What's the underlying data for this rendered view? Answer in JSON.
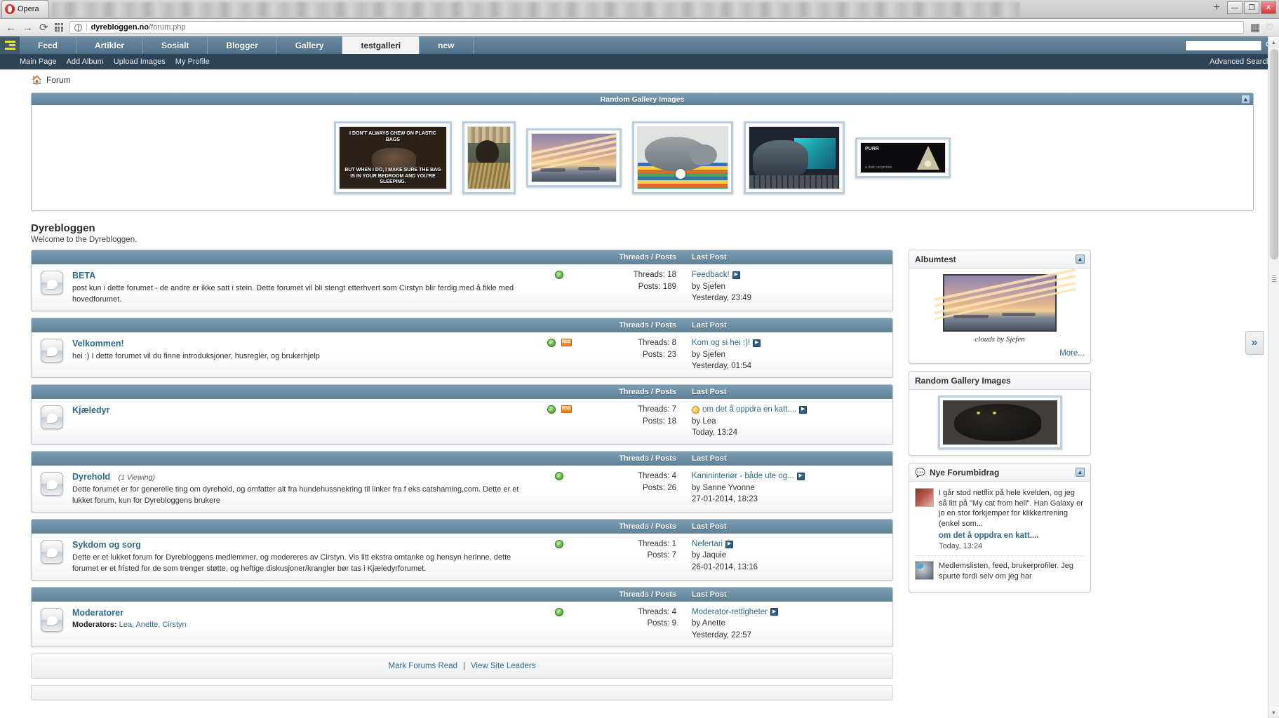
{
  "browser": {
    "tab_label": "Opera",
    "url_domain": "dyrebloggen.no",
    "url_path": "/forum.php",
    "new_tab_label": "+",
    "minimize_label": "—",
    "maximize_label": "❐",
    "close_label": "✕"
  },
  "site_nav": {
    "tabs": [
      {
        "label": "Feed",
        "active": false
      },
      {
        "label": "Artikler",
        "active": false
      },
      {
        "label": "Sosialt",
        "active": false
      },
      {
        "label": "Blogger",
        "active": false
      },
      {
        "label": "Gallery",
        "active": false
      },
      {
        "label": "testgalleri",
        "active": true
      },
      {
        "label": "new",
        "active": false
      }
    ],
    "search_value": "",
    "search_icon": "search-icon"
  },
  "sub_nav": {
    "links": [
      "Main Page",
      "Add Album",
      "Upload Images",
      "My Profile"
    ],
    "advanced_search": "Advanced Search"
  },
  "breadcrumb": {
    "home_icon": "home-icon",
    "label": "Forum"
  },
  "gallery_panel": {
    "title": "Random Gallery Images",
    "collapse_icon": "chevron-up-icon",
    "thumbs": [
      {
        "name": "meme-plastic-bags",
        "top_text": "I DON'T ALWAYS CHEW ON PLASTIC BAGS",
        "bottom_text": "BUT WHEN I DO, I MAKE SURE THE BAG IS IN YOUR BEDROOM AND YOU'RE SLEEPING."
      },
      {
        "name": "rabbit-hutch"
      },
      {
        "name": "sunset-clouds"
      },
      {
        "name": "cat-on-mat"
      },
      {
        "name": "cat-on-keyboard"
      },
      {
        "name": "dark-banner"
      }
    ]
  },
  "forum_header": {
    "title": "Dyrebloggen",
    "welcome": "Welcome to the Dyrebloggen."
  },
  "columns": {
    "threads_posts": "Threads / Posts",
    "last_post": "Last Post"
  },
  "forums": [
    {
      "name": "BETA",
      "viewing": "",
      "desc": "post kun i dette forumet - de andre er ikke satt i stein. Dette forumet vil bli stengt etterhvert som Cirstyn blir ferdig med å fikle med hovedforumet.",
      "mods": "",
      "flags": [
        "green-check-icon"
      ],
      "threads": "Threads: 18",
      "posts": "Posts: 189",
      "last_title": "Feedback!",
      "last_by": "by Sjefen",
      "last_time": "Yesterday, 23:49",
      "bulb": false
    },
    {
      "name": "Velkommen!",
      "viewing": "",
      "desc": "hei :) I dette forumet vil du finne introduksjoner, husregler, og brukerhjelp",
      "mods": "",
      "flags": [
        "green-check-icon",
        "rss-icon"
      ],
      "threads": "Threads: 8",
      "posts": "Posts: 23",
      "last_title": "Kom og si hei :)!",
      "last_by": "by Sjefen",
      "last_time": "Yesterday, 01:54",
      "bulb": false
    },
    {
      "name": "Kjæledyr",
      "viewing": "",
      "desc": "",
      "mods": "",
      "flags": [
        "green-check-icon",
        "rss-icon"
      ],
      "threads": "Threads: 7",
      "posts": "Posts: 18",
      "last_title": "om det å oppdra en katt....",
      "last_by": "by Lea",
      "last_time": "Today, 13:24",
      "bulb": true
    },
    {
      "name": "Dyrehold",
      "viewing": "(1 Viewing)",
      "desc": "Dette forumet er for generelle ting om dyrehold, og omfatter alt fra hundehussnekring til linker fra f eks catshaming,com. Dette er et lukket forum, kun for Dyrebloggens brukere",
      "mods": "",
      "flags": [
        "green-check-icon"
      ],
      "threads": "Threads: 4",
      "posts": "Posts: 26",
      "last_title": "Kanininteriør - både ute og...",
      "last_by": "by Sanne Yvonne",
      "last_time": "27-01-2014, 18:23",
      "bulb": false
    },
    {
      "name": "Sykdom og sorg",
      "viewing": "",
      "desc": "Dette er et lukket forum for Dyrebloggens medlemmer, og modereres av Cirstyn. Vis litt ekstra omtanke og hensyn herinne, dette forumet er et fristed for de som trenger støtte, og heftige diskusjoner/krangler bør tas i Kjæledyrforumet.",
      "mods": "",
      "flags": [
        "green-check-icon"
      ],
      "threads": "Threads: 1",
      "posts": "Posts: 7",
      "last_title": "Nefertari",
      "last_by": "by Jaquie",
      "last_time": "26-01-2014, 13:16",
      "bulb": false
    },
    {
      "name": "Moderatorer",
      "viewing": "",
      "desc": "",
      "mods_label": "Moderators:",
      "mods": "Lea, Anette, Cirstyn",
      "flags": [
        "green-check-icon"
      ],
      "threads": "Threads: 4",
      "posts": "Posts: 9",
      "last_title": "Moderator-rettigheter",
      "last_by": "by Anette",
      "last_time": "Yesterday, 22:57",
      "bulb": false
    }
  ],
  "bottom_links": {
    "mark_read": "Mark Forums Read",
    "separator": "|",
    "site_leaders": "View Site Leaders"
  },
  "sidebar": {
    "album_panel": {
      "title": "Albumtest",
      "collapse_icon": "chevron-up-icon",
      "image_name": "sunset-clouds-thumb",
      "caption": "clouds by Sjefen",
      "more": "More..."
    },
    "random_gallery_panel": {
      "title": "Random Gallery Images",
      "image_name": "black-cat-thumb"
    },
    "new_posts_panel": {
      "title": "Nye Forumbidrag",
      "icon": "speech-bubble-icon",
      "collapse_icon": "chevron-up-icon",
      "posts": [
        {
          "avatar": "avatar-cat-red",
          "excerpt": "I går stod netflix på hele kvelden, og jeg så litt på \"My cat from hell\". Han Galaxy er jo en stor forkjemper for klikkertrening (enkel som...",
          "title": "om det å oppdra en katt....",
          "time": "Today, 13:24"
        },
        {
          "avatar": "avatar-bird",
          "excerpt": "Medlemslisten, feed, brukerprofiler. Jeg spurte fordi selv om jeg har",
          "title": "",
          "time": ""
        }
      ]
    }
  },
  "rail": {
    "expand_icon": "double-chevron-right-icon"
  },
  "colors": {
    "nav_blue": "#5f8299",
    "header_blue": "#7d9db4",
    "link_blue": "#2f6b8f",
    "dark_nav": "#2f4356",
    "green_status": "#3f9a2e",
    "rss_orange": "#e87b1e"
  }
}
